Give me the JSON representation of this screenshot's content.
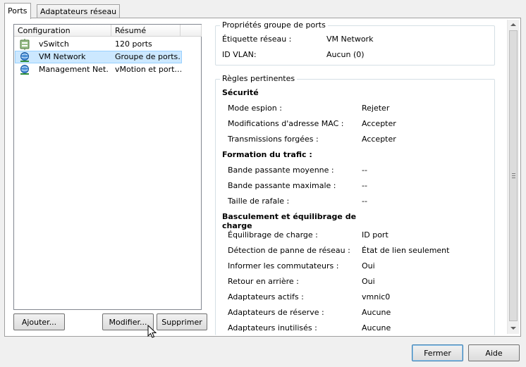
{
  "tabs": [
    {
      "label": "Ports",
      "active": true
    },
    {
      "label": "Adaptateurs réseau",
      "active": false
    }
  ],
  "port_list": {
    "columns": [
      "Configuration",
      "Résumé"
    ],
    "rows": [
      {
        "icon": "vswitch-icon",
        "name": "vSwitch",
        "summary": "120 ports",
        "selected": false
      },
      {
        "icon": "vm-network-icon",
        "name": "VM Network",
        "summary": "Groupe de ports…",
        "selected": true
      },
      {
        "icon": "vmkernel-port-icon",
        "name": "Management Net…",
        "summary": "vMotion et port…",
        "selected": false
      }
    ]
  },
  "buttons": {
    "add": "Ajouter...",
    "edit": "Modifier...",
    "remove": "Supprimer",
    "close": "Fermer",
    "help": "Aide"
  },
  "port_group_properties": {
    "title": "Propriétés groupe de ports",
    "rows": [
      {
        "label": "Étiquette réseau :",
        "value": "VM Network"
      },
      {
        "label": "ID VLAN:",
        "value": "Aucun (0)"
      }
    ]
  },
  "policies": {
    "title": "Règles pertinentes",
    "security": {
      "title": "Sécurité",
      "rows": [
        {
          "label": "Mode espion :",
          "value": "Rejeter"
        },
        {
          "label": "Modifications d'adresse MAC :",
          "value": "Accepter"
        },
        {
          "label": "Transmissions forgées :",
          "value": "Accepter"
        }
      ]
    },
    "traffic_shaping": {
      "title": "Formation du trafic :",
      "rows": [
        {
          "label": "Bande passante moyenne :",
          "value": "--"
        },
        {
          "label": "Bande passante maximale :",
          "value": "--"
        },
        {
          "label": "Taille de rafale :",
          "value": "--"
        }
      ]
    },
    "failover": {
      "title_line1": "Basculement et équilibrage de",
      "title_line2": "charge",
      "rows": [
        {
          "label": "Équilibrage de charge :",
          "value": "ID port"
        },
        {
          "label": "Détection de panne de réseau :",
          "value": "État de lien seulement"
        },
        {
          "label": "Informer les commutateurs :",
          "value": "Oui"
        },
        {
          "label": "Retour en arrière :",
          "value": "Oui"
        },
        {
          "label": "Adaptateurs actifs :",
          "value": "vmnic0"
        },
        {
          "label": "Adaptateurs de réserve :",
          "value": "Aucune"
        },
        {
          "label": "Adaptateurs inutilisés :",
          "value": "Aucune"
        }
      ]
    }
  },
  "colors": {
    "selection_bg": "#cce8ff",
    "selection_border": "#99d1ff",
    "group_border": "#d5dfe5"
  }
}
